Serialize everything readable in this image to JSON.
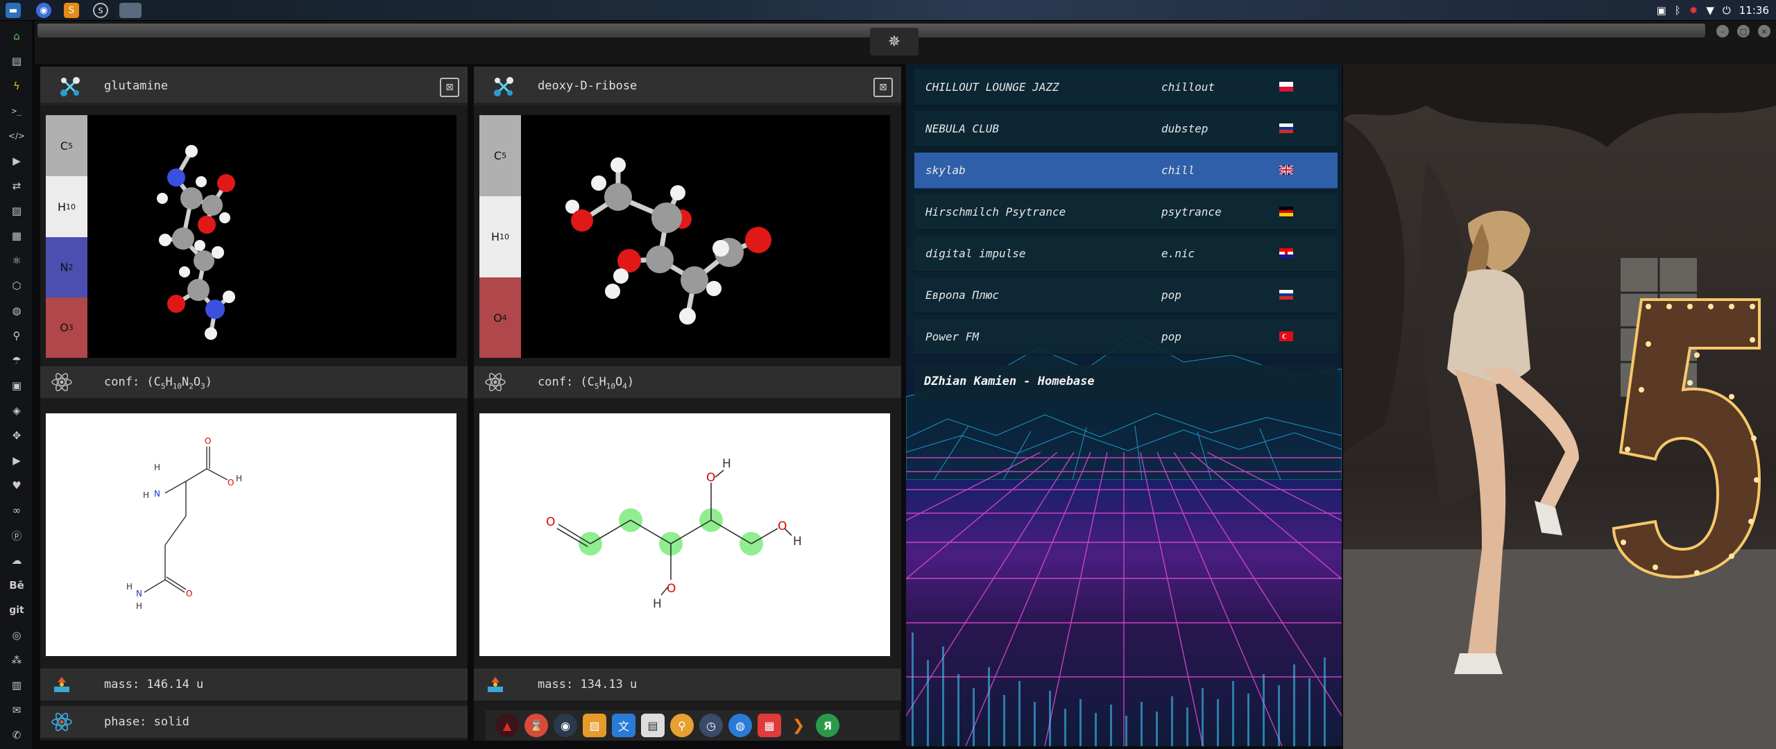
{
  "system": {
    "clock": "11:36",
    "tray_icons": [
      "picture-icon",
      "bluetooth-icon",
      "settings-gear-icon",
      "wifi-icon",
      "power-icon"
    ],
    "top_left_icons": [
      "files-icon",
      "chrome-icon",
      "sublime-icon",
      "s-icon",
      "window-icon"
    ]
  },
  "launcher": {
    "icons": [
      "home-icon",
      "document-icon",
      "bolt-icon",
      "terminal-icon",
      "code-icon",
      "play-icon",
      "translate-icon",
      "image-icon",
      "news-icon",
      "react-icon",
      "hexagon-icon",
      "globe-icon",
      "search-icon",
      "umbrella-icon",
      "contact-icon",
      "tag-icon",
      "expand-icon",
      "youtube-icon",
      "heart-icon",
      "infinity-icon",
      "pinterest-icon",
      "cloud-icon",
      "behance-icon",
      "git-icon",
      "github-icon",
      "network-icon",
      "map-icon",
      "mail-icon",
      "phone-icon"
    ],
    "behance_label": "Bē",
    "git_label": "git"
  },
  "molecules": [
    {
      "name": "glutamine",
      "formula_bar": [
        {
          "el": "C",
          "n": "5",
          "color": "#b0b0b0"
        },
        {
          "el": "H",
          "n": "10",
          "color": "#ececec"
        },
        {
          "el": "N",
          "n": "2",
          "color": "#4a4fb0"
        },
        {
          "el": "O",
          "n": "3",
          "color": "#b0474a"
        }
      ],
      "conf_prefix": "conf: (",
      "conf_formula": [
        {
          "el": "C",
          "n": "5"
        },
        {
          "el": "H",
          "n": "10"
        },
        {
          "el": "N",
          "n": "2"
        },
        {
          "el": "O",
          "n": "3"
        }
      ],
      "conf_suffix": ")",
      "mass": "mass: 146.14 u",
      "phase": "phase: solid",
      "structure_labels": {
        "h1": "H",
        "n": "N",
        "h2": "H",
        "o_top": "O",
        "o_right": "O",
        "h_right": "H",
        "h_bl1": "H",
        "n_bl": "N",
        "h_bl2": "H",
        "o_bl": "O"
      }
    },
    {
      "name": "deoxy-D-ribose",
      "formula_bar": [
        {
          "el": "C",
          "n": "5",
          "color": "#b0b0b0"
        },
        {
          "el": "H",
          "n": "10",
          "color": "#ececec"
        },
        {
          "el": "O",
          "n": "4",
          "color": "#b0474a"
        }
      ],
      "conf_prefix": "conf: (",
      "conf_formula": [
        {
          "el": "C",
          "n": "5"
        },
        {
          "el": "H",
          "n": "10"
        },
        {
          "el": "O",
          "n": "4"
        }
      ],
      "conf_suffix": ")",
      "mass": "mass: 134.13 u",
      "structure_labels": {
        "o_left": "O",
        "o_top": "O",
        "h_top": "H",
        "o_bottom": "O",
        "h_bottom": "H",
        "o_right": "O",
        "h_right": "H"
      }
    }
  ],
  "dock": {
    "icons": [
      "triangle-app-icon",
      "hourglass-icon",
      "steam-icon",
      "photos-icon",
      "translate-icon",
      "newspaper-icon",
      "magnifier-icon",
      "clock-icon",
      "globe-icon",
      "calendar-icon",
      "arrow-icon",
      "yandex-icon"
    ],
    "yandex_label": "Я"
  },
  "radio": {
    "stations": [
      {
        "name": "CHILLOUT LOUNGE JAZZ",
        "genre": "chillout",
        "flag": "pl"
      },
      {
        "name": "NEBULA CLUB",
        "genre": "dubstep",
        "flag": "ru"
      },
      {
        "name": "skylab",
        "genre": "chill",
        "flag": "gb",
        "selected": true
      },
      {
        "name": "Hirschmilch Psytrance",
        "genre": "psytrance",
        "flag": "de"
      },
      {
        "name": "digital impulse",
        "genre": "e.nic",
        "flag": "hr"
      },
      {
        "name": "Европа Плюс",
        "genre": "pop",
        "flag": "ru"
      },
      {
        "name": "Power FM",
        "genre": "pop",
        "flag": "tr"
      }
    ],
    "now_playing": "DZhian Kamien - Homebase"
  }
}
